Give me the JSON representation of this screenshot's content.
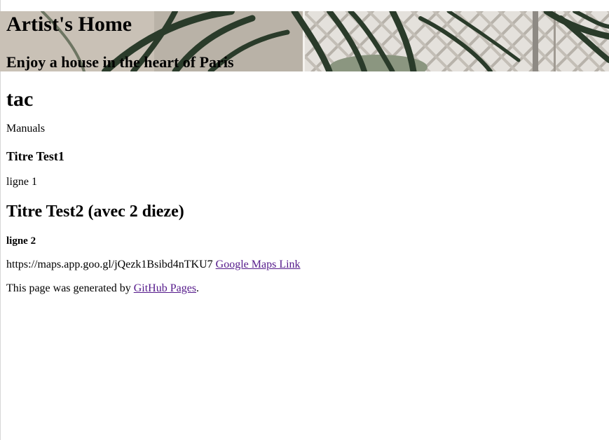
{
  "header": {
    "title": "Artist's Home",
    "tagline": "Enjoy a house in the heart of Paris"
  },
  "main": {
    "heading": "tac",
    "manuals": "Manuals",
    "test1_title": "Titre Test1",
    "test1_line": "ligne 1",
    "test2_title": "Titre Test2 (avec 2 dieze)",
    "test2_line": "ligne 2",
    "maps_url_text": "https://maps.app.goo.gl/jQezk1Bsibd4nTKU7",
    "maps_link_label": "Google Maps Link"
  },
  "footer": {
    "prefix": "This page was generated by ",
    "link_label": "GitHub Pages",
    "suffix": "."
  },
  "colors": {
    "visited_link": "#551a8b",
    "text": "#000000",
    "background": "#ffffff"
  }
}
